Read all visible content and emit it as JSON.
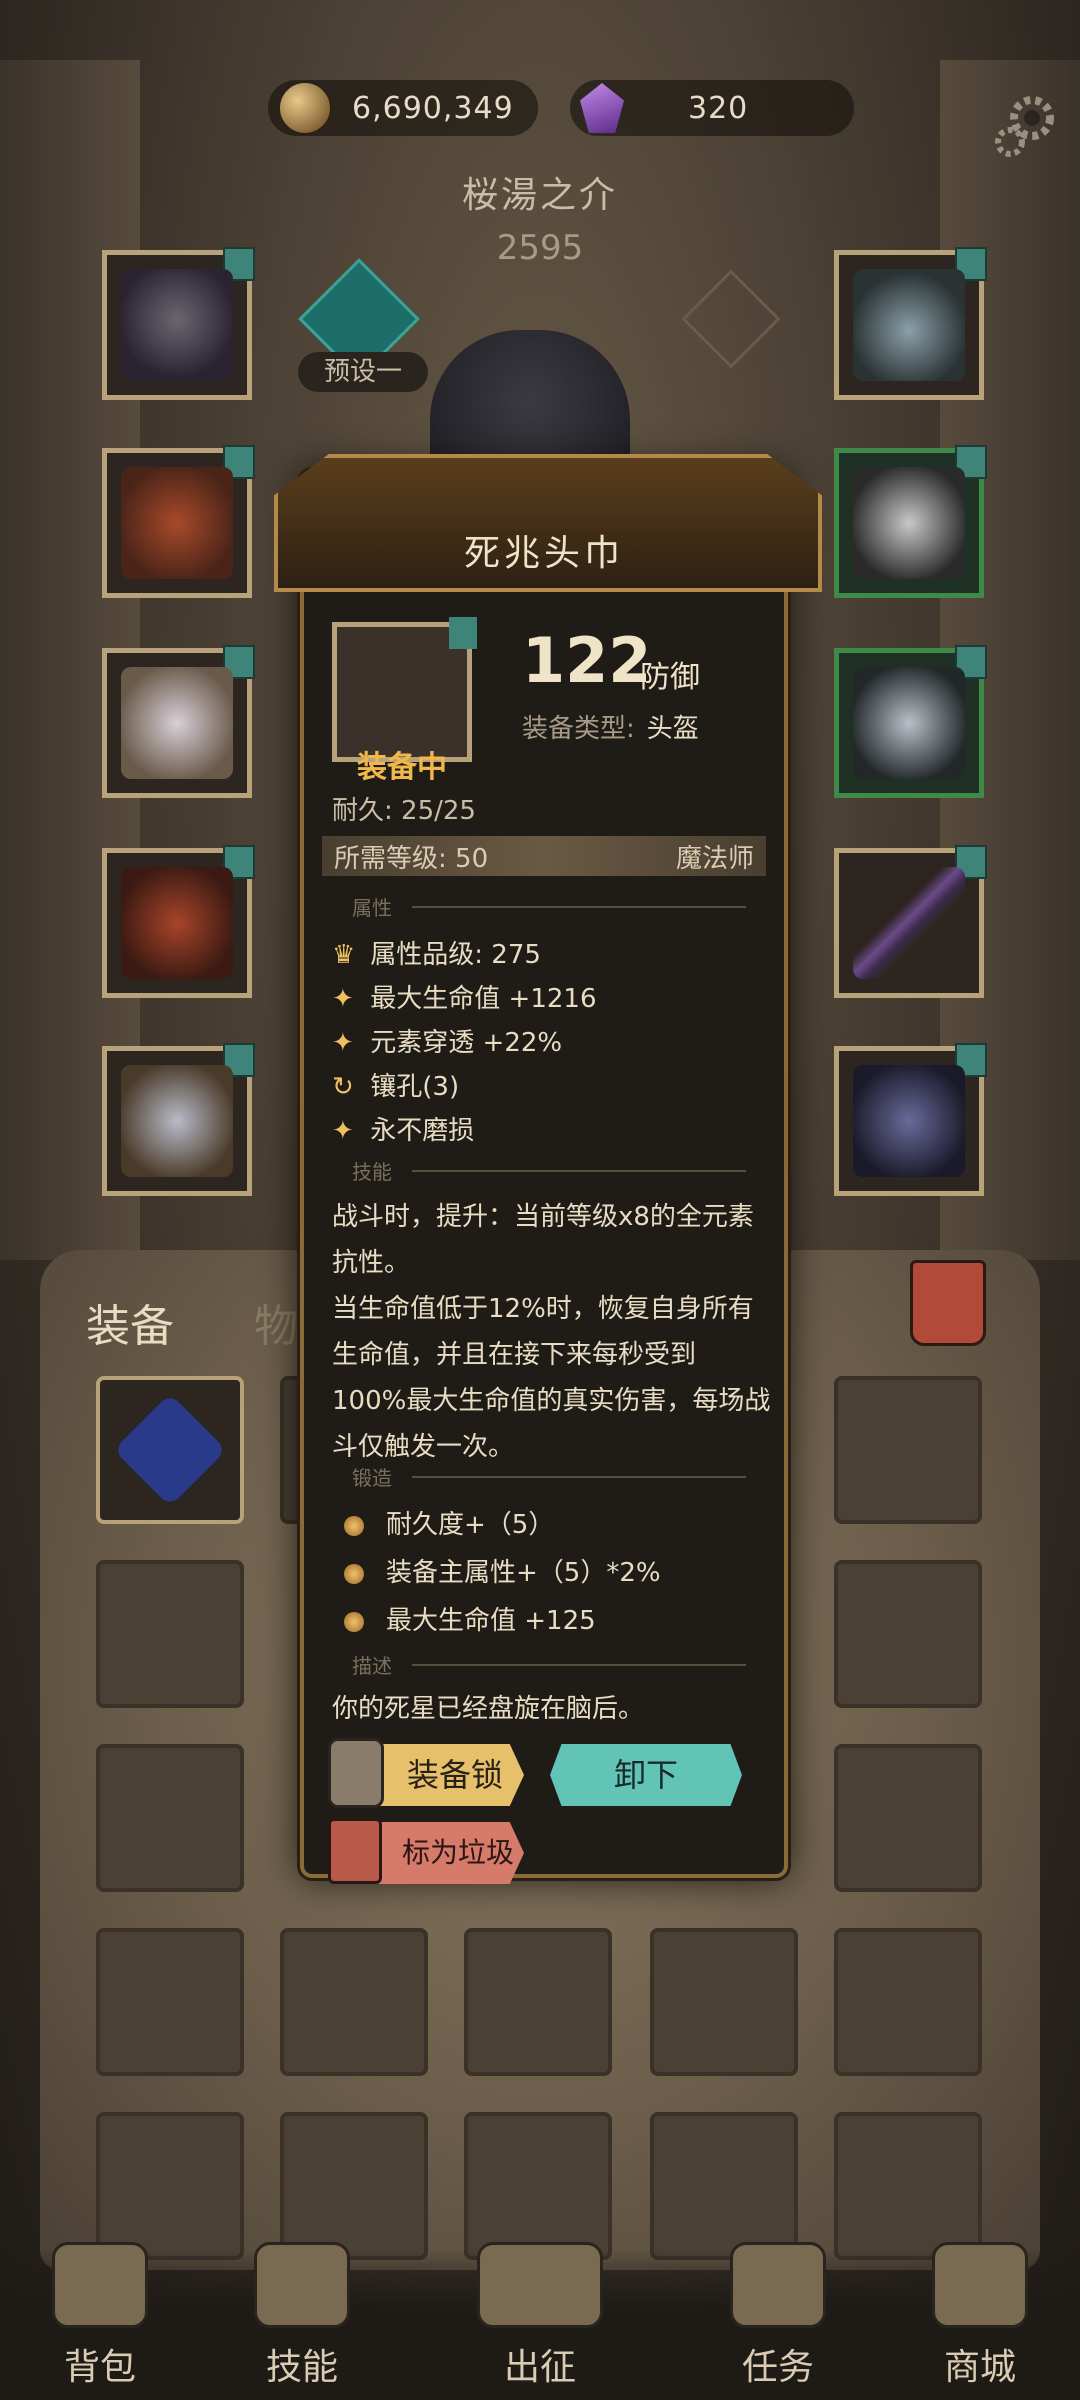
{
  "top_bar": {
    "coins": "6,690,349",
    "gems": "320",
    "coin_icon": "coin-icon",
    "gem_icon": "gem-icon",
    "settings_icon": "gear-icon"
  },
  "hero": {
    "name": "桜湯之介",
    "power": "2595",
    "preset_label": "预设一"
  },
  "tabs": {
    "equip": "装备",
    "items": "物品"
  },
  "popup": {
    "title": "死兆头巾",
    "equipped_label": "装备中",
    "defense_value": "122",
    "defense_label": "防御",
    "type_label": "装备类型:",
    "type_value": "头盔",
    "durability": "耐久: 25/25",
    "required_level": "所需等级: 50",
    "class": "魔法师",
    "section_attributes": "属性",
    "attributes": [
      {
        "icon": "tier-icon",
        "text": "属性品级: 275"
      },
      {
        "icon": "star-icon",
        "text": "最大生命值 +1216"
      },
      {
        "icon": "star-icon",
        "text": "元素穿透 +22%"
      },
      {
        "icon": "socket-icon",
        "text": "镶孔(3)"
      },
      {
        "icon": "star-icon",
        "text": "永不磨损"
      }
    ],
    "section_skills": "技能",
    "skill_lines": [
      "战斗时，提升：当前等级x8的全元素",
      "抗性。",
      "当生命值低于12%时，恢复自身所有",
      "生命值，并且在接下来每秒受到",
      "100%最大生命值的真实伤害，每场战",
      "斗仅触发一次。"
    ],
    "section_forge": "锻造",
    "forge": [
      "耐久度+（5）",
      "装备主属性+（5）*2%",
      "最大生命值 +125"
    ],
    "section_desc": "描述",
    "description": "你的死星已经盘旋在脑后。",
    "btn_lock": "装备锁",
    "btn_remove": "卸下",
    "btn_junk": "标为垃圾"
  },
  "nav": [
    {
      "label": "背包",
      "icon": "backpack-icon"
    },
    {
      "label": "技能",
      "icon": "skill-book-icon"
    },
    {
      "label": "出征",
      "icon": "sword-map-icon"
    },
    {
      "label": "任务",
      "icon": "scroll-icon"
    },
    {
      "label": "商城",
      "icon": "shop-crown-icon"
    }
  ],
  "colors": {
    "accent_gold": "#f0b84a",
    "teal": "#62c4b6",
    "junk_red": "#d67a6a"
  }
}
